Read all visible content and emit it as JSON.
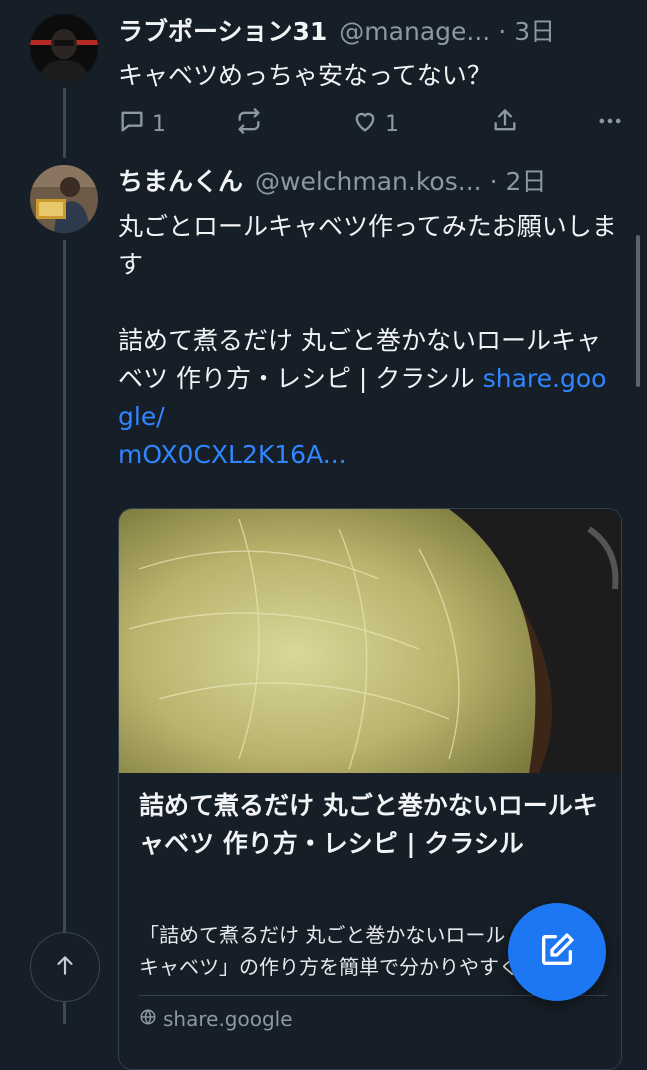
{
  "posts": [
    {
      "name": "ラブポーション31",
      "handle": "@manage...",
      "separator": "·",
      "time": "3日",
      "text": "キャベツめっちゃ安なってない？",
      "actions": {
        "reply_count": "1",
        "repost_count": "",
        "like_count": "1"
      }
    },
    {
      "name": "ちまんくん",
      "handle": "@welchman.kos...",
      "separator": "·",
      "time": "2日",
      "text": "丸ごとロールキャベツ作ってみたお願いします\n\n詰めて煮るだけ 丸ごと巻かないロールキャベツ 作り方・レシピ | クラシル ",
      "link_text": "share.google/\nmOX0CXL2K16A...",
      "card": {
        "title": "詰めて煮るだけ 丸ごと巻かないロールキャベツ 作り方・レシピ | クラシル",
        "description": "「詰めて煮るだけ 丸ごと巻かないロール\nキャベツ」の作り方を簡単で分かりやすく",
        "domain": "share.google"
      }
    }
  ],
  "colors": {
    "background": "#161e27",
    "accent": "#1d77f2",
    "link": "#2f86ff",
    "muted": "#8b98a5"
  },
  "icons": {
    "reply": "speech-bubble-icon",
    "repost": "repost-arrows-icon",
    "like": "heart-icon",
    "share": "share-icon",
    "more": "more-dots-icon",
    "scroll_top": "arrow-up-icon",
    "compose": "compose-pencil-icon"
  }
}
